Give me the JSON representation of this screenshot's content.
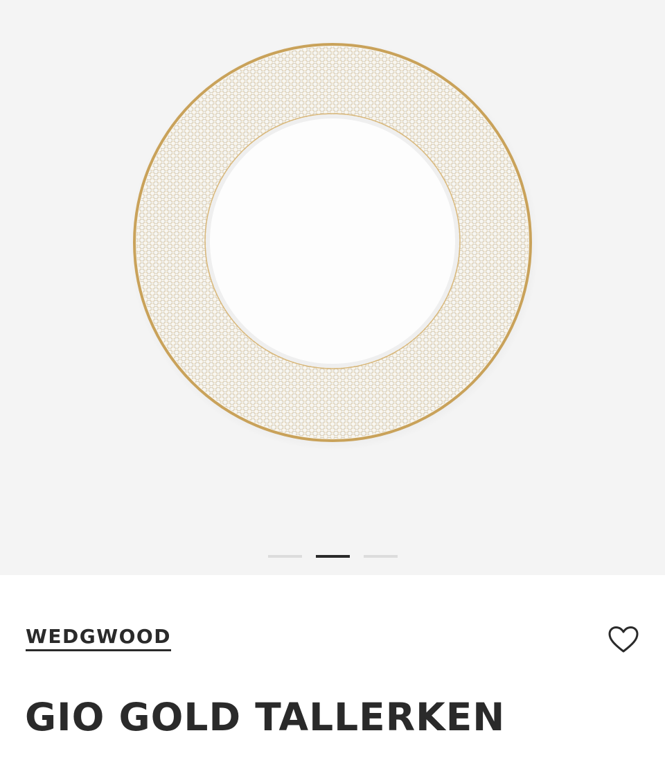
{
  "gallery": {
    "image_alt": "Gio Gold tallerken",
    "slide_count": 3,
    "active_slide": 2,
    "colors": {
      "background": "#f4f4f4",
      "plate": "#ffffff",
      "gold_rim": "#c9a25a",
      "pattern": "#d9d4c8"
    }
  },
  "product": {
    "brand": "WEDGWOOD",
    "title": "GIO GOLD TALLERKEN",
    "wishlist_icon": "heart-outline-icon"
  },
  "colors": {
    "text": "#2a2a2a",
    "pager_inactive": "#dcdcdc",
    "pager_active": "#2a2a2a"
  }
}
